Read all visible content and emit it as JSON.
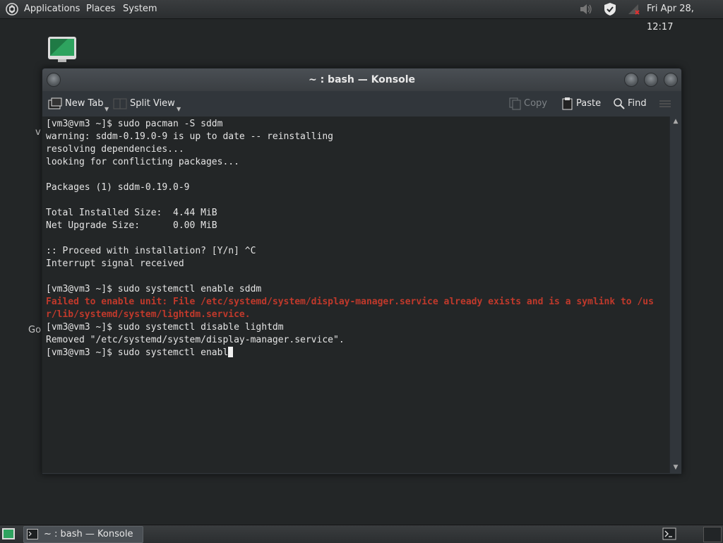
{
  "top_panel": {
    "menus": [
      "Applications",
      "Places",
      "System"
    ],
    "clock": "Fri Apr 28, 12:17",
    "icons": [
      "distro-logo-icon",
      "volume-icon",
      "shield-icon",
      "network-disconnected-icon"
    ]
  },
  "desktop": {
    "labels": [
      "v",
      "Go"
    ]
  },
  "window": {
    "title": "~ : bash — Konsole"
  },
  "toolbar": {
    "new_tab": "New Tab",
    "split_view": "Split View",
    "copy": "Copy",
    "paste": "Paste",
    "find": "Find"
  },
  "terminal": {
    "lines": [
      "[vm3@vm3 ~]$ sudo pacman -S sddm",
      "warning: sddm-0.19.0-9 is up to date -- reinstalling",
      "resolving dependencies...",
      "looking for conflicting packages...",
      "",
      "Packages (1) sddm-0.19.0-9",
      "",
      "Total Installed Size:  4.44 MiB",
      "Net Upgrade Size:      0.00 MiB",
      "",
      ":: Proceed with installation? [Y/n] ^C",
      "Interrupt signal received",
      "",
      "[vm3@vm3 ~]$ sudo systemctl enable sddm",
      "Failed to enable unit: File /etc/systemd/system/display-manager.service already exists and is a symlink to /us",
      "r/lib/systemd/system/lightdm.service.",
      "[vm3@vm3 ~]$ sudo systemctl disable lightdm",
      "Removed \"/etc/systemd/system/display-manager.service\".",
      "[vm3@vm3 ~]$ sudo systemctl enabl"
    ],
    "error_color": "#c0392b"
  },
  "taskbar": {
    "task_label": "~ : bash — Konsole"
  }
}
